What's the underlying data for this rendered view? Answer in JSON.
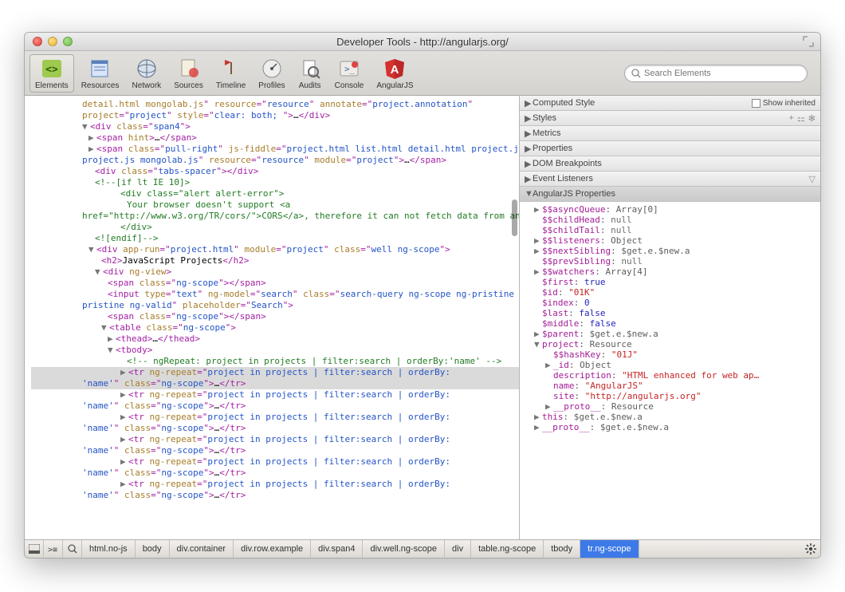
{
  "window": {
    "title": "Developer Tools - http://angularjs.org/"
  },
  "toolbar": {
    "items": [
      {
        "id": "elements",
        "label": "Elements"
      },
      {
        "id": "resources",
        "label": "Resources"
      },
      {
        "id": "network",
        "label": "Network"
      },
      {
        "id": "sources",
        "label": "Sources"
      },
      {
        "id": "timeline",
        "label": "Timeline"
      },
      {
        "id": "profiles",
        "label": "Profiles"
      },
      {
        "id": "audits",
        "label": "Audits"
      },
      {
        "id": "console",
        "label": "Console"
      },
      {
        "id": "angularjs",
        "label": "AngularJS"
      }
    ],
    "search_placeholder": "Search Elements"
  },
  "dom": {
    "frag1_a": "detail.html mongolab.js",
    "frag1_b": "resource",
    "frag1_c": "resource",
    "frag1_d": "annotate",
    "frag1_e": "project.annotation",
    "frag2_a": "project",
    "frag2_b": "style",
    "frag2_c": "clear: both; ",
    "span4": "span4",
    "hint": "hint",
    "pullr": "pull-right",
    "jsfiddle": "js-fiddle",
    "jsfiddle_v": "project.html list.html detail.html project.js mongolab.js",
    "res": "resource",
    "res_v": "resource",
    "mod": "module",
    "mod_v": "project",
    "tabs": "tabs-spacer",
    "cmt_if": "<!--[if lt IE 10]>",
    "alert": "alert alert-error",
    "txt1": "Your browser doesn't support ",
    "cors": "CORS",
    "cors_href": "http://www.w3.org/TR/cors/",
    "txt2": ", therefore it can not fetch data from an external domain resulting in no projects shown in this example.",
    "cmt_end": "<![endif]-->",
    "apprun": "app-run",
    "apprun_v": "project.html",
    "well": "well ng-scope",
    "h2": "JavaScript Projects",
    "ngview": "ng-view",
    "ngscope": "ng-scope",
    "input_attrs": {
      "type": "text",
      "ngmodel": "search",
      "cls": "search-query ng-scope ng-pristine ng-valid",
      "ph": "Search"
    },
    "repeat_cmt": "<!-- ngRepeat: project in projects | filter:search | orderBy:'name' -->",
    "ngrepeat": "ng-repeat",
    "ngrepeat_v": "project in projects | filter:search | orderBy:'name'"
  },
  "side": {
    "sections": {
      "computed": "Computed Style",
      "styles": "Styles",
      "metrics": "Metrics",
      "properties": "Properties",
      "dombp": "DOM Breakpoints",
      "evt": "Event Listeners",
      "ng": "AngularJS Properties"
    },
    "showinh": "Show inherited",
    "props": {
      "asyncQueue": {
        "k": "$$asyncQueue",
        "v": "Array[0]"
      },
      "childHead": {
        "k": "$$childHead",
        "v": "null"
      },
      "childTail": {
        "k": "$$childTail",
        "v": "null"
      },
      "listeners": {
        "k": "$$listeners",
        "v": "Object"
      },
      "nextSibling": {
        "k": "$$nextSibling",
        "v": "$get.e.$new.a"
      },
      "prevSibling": {
        "k": "$$prevSibling",
        "v": "null"
      },
      "watchers": {
        "k": "$$watchers",
        "v": "Array[4]"
      },
      "first": {
        "k": "$first",
        "v": "true"
      },
      "id": {
        "k": "$id",
        "v": "\"01K\""
      },
      "index": {
        "k": "$index",
        "v": "0"
      },
      "last": {
        "k": "$last",
        "v": "false"
      },
      "middle": {
        "k": "$middle",
        "v": "false"
      },
      "parent": {
        "k": "$parent",
        "v": "$get.e.$new.a"
      },
      "project": {
        "k": "project",
        "v": "Resource"
      },
      "hashKey": {
        "k": "$$hashKey",
        "v": "\"01J\""
      },
      "plid": {
        "k": "_id",
        "v": "Object"
      },
      "desc": {
        "k": "description",
        "v": "\"HTML enhanced for web ap…"
      },
      "name": {
        "k": "name",
        "v": "\"AngularJS\""
      },
      "site": {
        "k": "site",
        "v": "\"http://angularjs.org\""
      },
      "proto1": {
        "k": "__proto__",
        "v": "Resource"
      },
      "this": {
        "k": "this",
        "v": "$get.e.$new.a"
      },
      "proto2": {
        "k": "__proto__",
        "v": "$get.e.$new.a"
      }
    }
  },
  "breadcrumbs": [
    "html.no-js",
    "body",
    "div.container",
    "div.row.example",
    "div.span4",
    "div.well.ng-scope",
    "div",
    "table.ng-scope",
    "tbody",
    "tr.ng-scope"
  ]
}
